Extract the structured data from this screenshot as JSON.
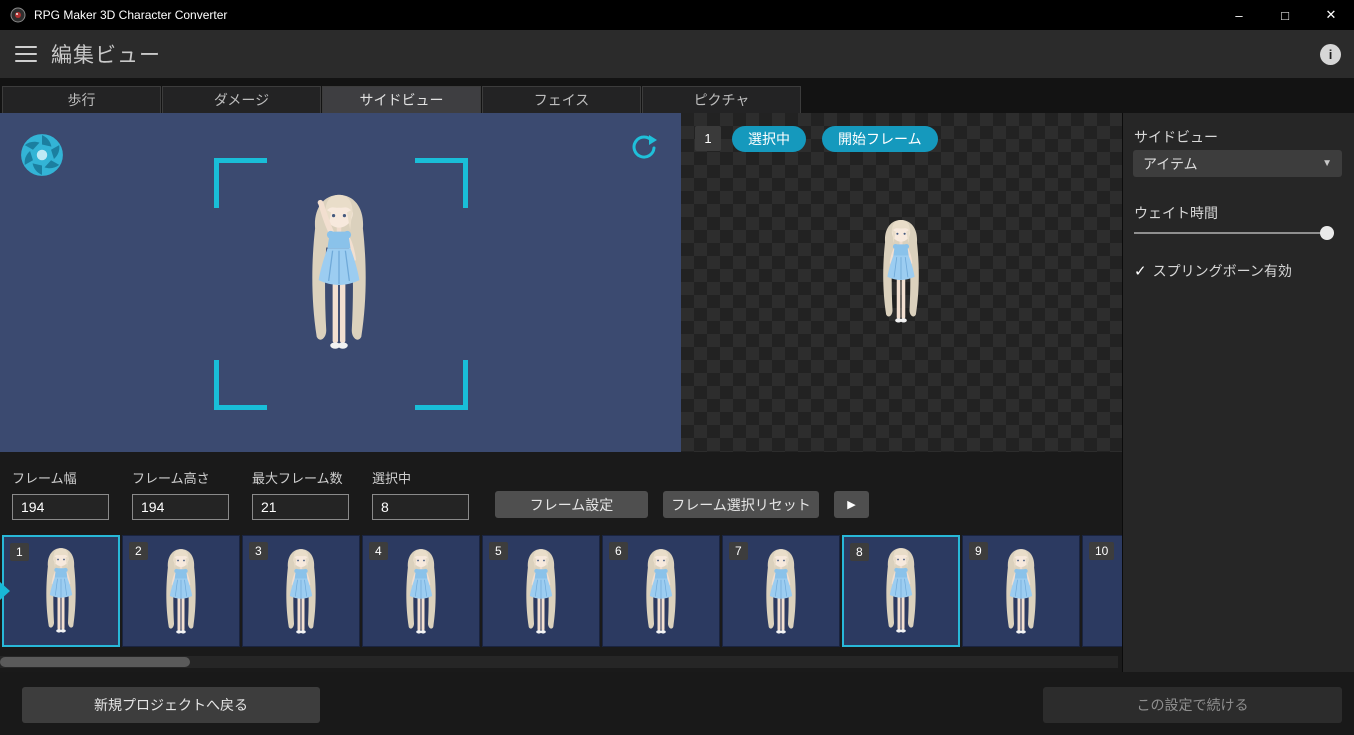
{
  "window": {
    "title": "RPG Maker 3D Character Converter"
  },
  "icons": {
    "minimize": "–",
    "maximize": "□",
    "close": "✕",
    "info": "i",
    "chevron_down": "▼",
    "check": "✓",
    "play": "▶"
  },
  "colors": {
    "accent_teal": "#1599bd",
    "preview_blue": "#3b4a70",
    "bracket_teal": "#19bed8"
  },
  "header": {
    "title": "編集ビュー"
  },
  "tabs": [
    {
      "label": "歩行",
      "active": false
    },
    {
      "label": "ダメージ",
      "active": false
    },
    {
      "label": "サイドビュー",
      "active": true
    },
    {
      "label": "フェイス",
      "active": false
    },
    {
      "label": "ピクチャ",
      "active": false
    }
  ],
  "preview": {
    "frame_badge": "1",
    "selected_label": "選択中",
    "start_frame_label": "開始フレーム"
  },
  "sidebar": {
    "title": "サイドビュー",
    "dropdown_value": "アイテム",
    "wait_label": "ウェイト時間",
    "springbone_label": "スプリングボーン有効",
    "springbone_checked": true
  },
  "frame_controls": {
    "fields": [
      {
        "label": "フレーム幅",
        "value": "194"
      },
      {
        "label": "フレーム高さ",
        "value": "194"
      },
      {
        "label": "最大フレーム数",
        "value": "21"
      },
      {
        "label": "選択中",
        "value": "8"
      }
    ],
    "settings_label": "フレーム設定",
    "reset_label": "フレーム選択リセット"
  },
  "filmstrip": {
    "frames": [
      {
        "number": "1",
        "selected": true,
        "current": true
      },
      {
        "number": "2",
        "selected": false,
        "current": false
      },
      {
        "number": "3",
        "selected": false,
        "current": false
      },
      {
        "number": "4",
        "selected": false,
        "current": false
      },
      {
        "number": "5",
        "selected": false,
        "current": false
      },
      {
        "number": "6",
        "selected": false,
        "current": false
      },
      {
        "number": "7",
        "selected": false,
        "current": false
      },
      {
        "number": "8",
        "selected": true,
        "current": false
      },
      {
        "number": "9",
        "selected": false,
        "current": false
      },
      {
        "number": "10",
        "selected": false,
        "current": false
      }
    ]
  },
  "footer": {
    "back_label": "新規プロジェクトへ戻る",
    "continue_label": "この設定で続ける"
  }
}
